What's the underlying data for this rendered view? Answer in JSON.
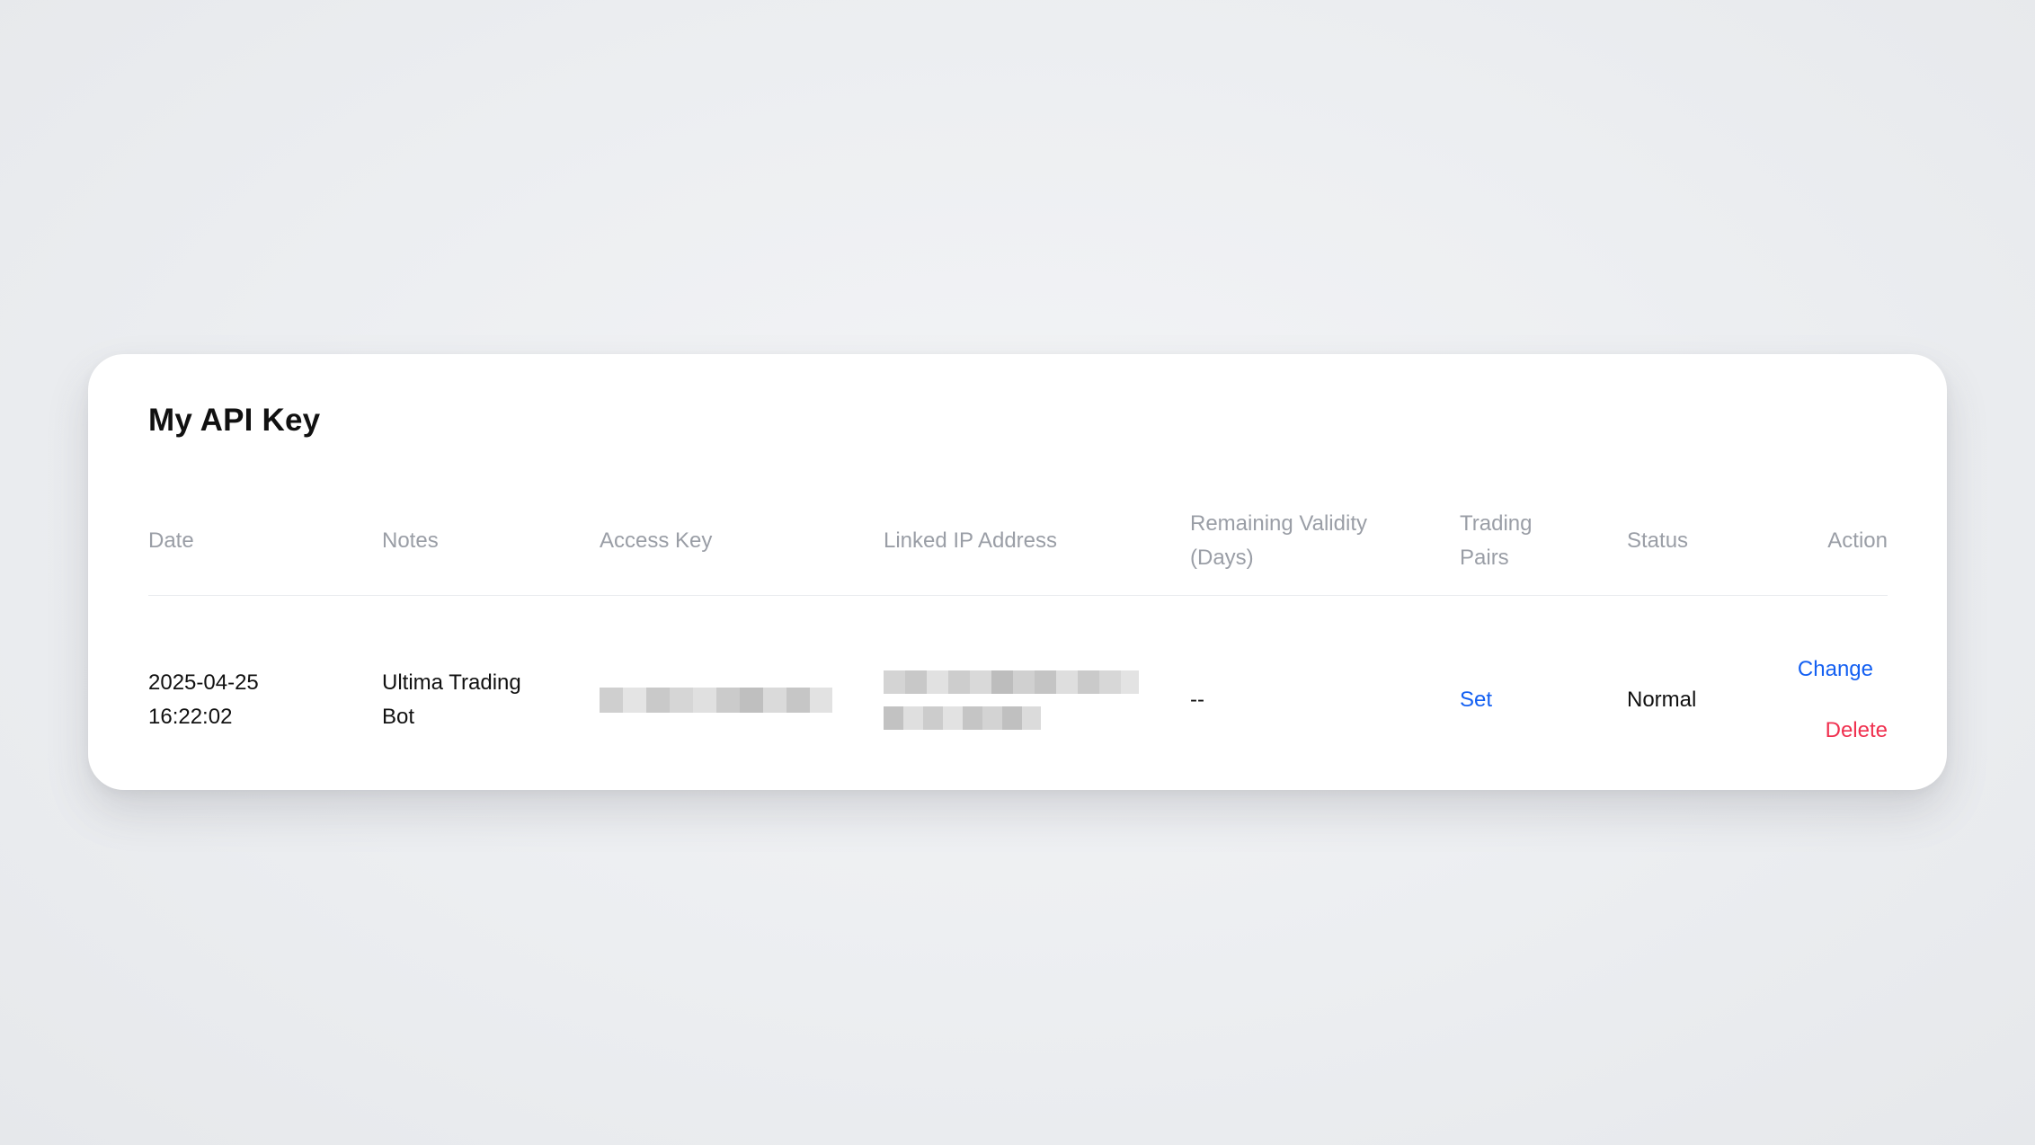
{
  "page": {
    "title": "My API Key"
  },
  "table": {
    "columns": [
      {
        "key": "date",
        "label": "Date"
      },
      {
        "key": "notes",
        "label": "Notes"
      },
      {
        "key": "access_key",
        "label": "Access Key"
      },
      {
        "key": "linked_ip",
        "label": "Linked IP Address"
      },
      {
        "key": "remaining",
        "label_line1": "Remaining Validity",
        "label_line2": "(Days)"
      },
      {
        "key": "pairs",
        "label_line1": "Trading",
        "label_line2": "Pairs"
      },
      {
        "key": "status",
        "label": "Status"
      },
      {
        "key": "action",
        "label": "Action"
      }
    ],
    "rows": [
      {
        "date_line1": "2025-04-25",
        "date_line2": "16:22:02",
        "notes_line1": "Ultima Trading",
        "notes_line2": "Bot",
        "access_key_state": "redacted",
        "linked_ip_state": "redacted",
        "remaining": "--",
        "pairs_label": "Set",
        "status": "Normal",
        "change_label": "Change",
        "delete_label": "Delete"
      }
    ]
  },
  "colors": {
    "link_blue": "#1460f2",
    "danger_red": "#f0304f",
    "header_text": "#9a9ea6",
    "body_text": "#111111"
  }
}
